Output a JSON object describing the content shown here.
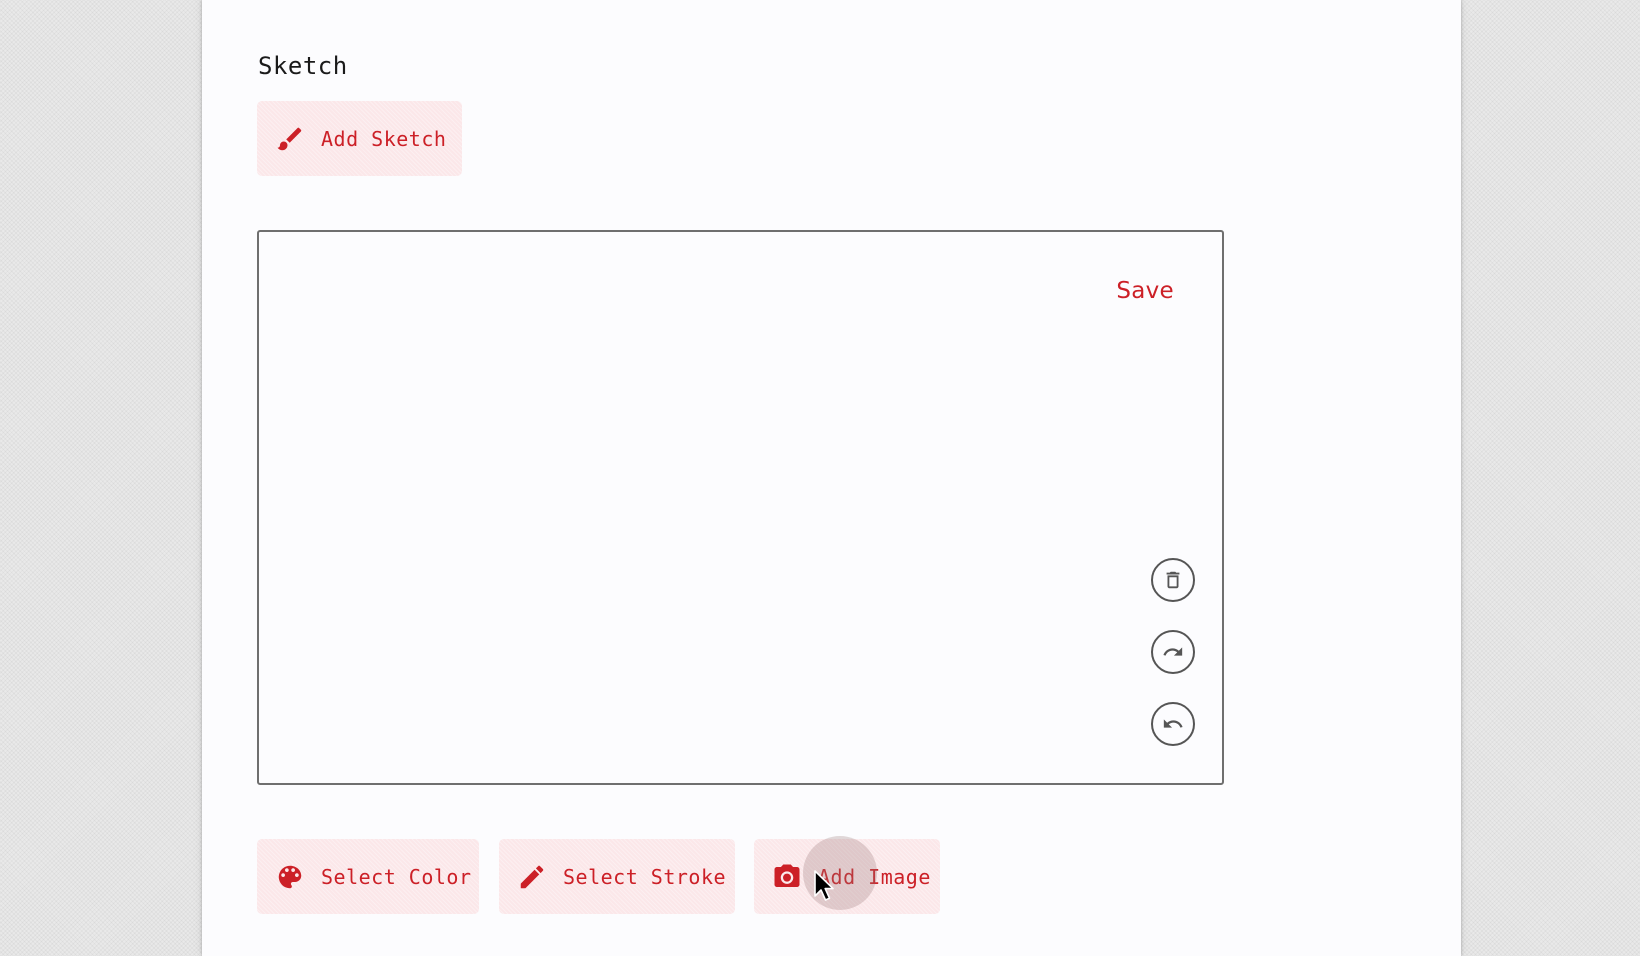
{
  "section": {
    "title": "Sketch"
  },
  "toolbar": {
    "add_sketch_label": "Add Sketch",
    "add_sketch_icon": "brush-icon"
  },
  "canvas": {
    "save_label": "Save",
    "tools": [
      {
        "name": "delete",
        "icon": "trash-icon"
      },
      {
        "name": "redo",
        "icon": "redo-icon"
      },
      {
        "name": "undo",
        "icon": "undo-icon"
      }
    ]
  },
  "bottom_actions": {
    "select_color_label": "Select Color",
    "select_color_icon": "palette-icon",
    "select_stroke_label": "Select Stroke",
    "select_stroke_icon": "pencil-icon",
    "add_image_label": "Add Image",
    "add_image_icon": "camera-icon"
  },
  "colors": {
    "accent": "#cc2027",
    "button_bg": "#fbe7e9",
    "tool_border": "#555555",
    "canvas_border": "#6f6f6f"
  }
}
